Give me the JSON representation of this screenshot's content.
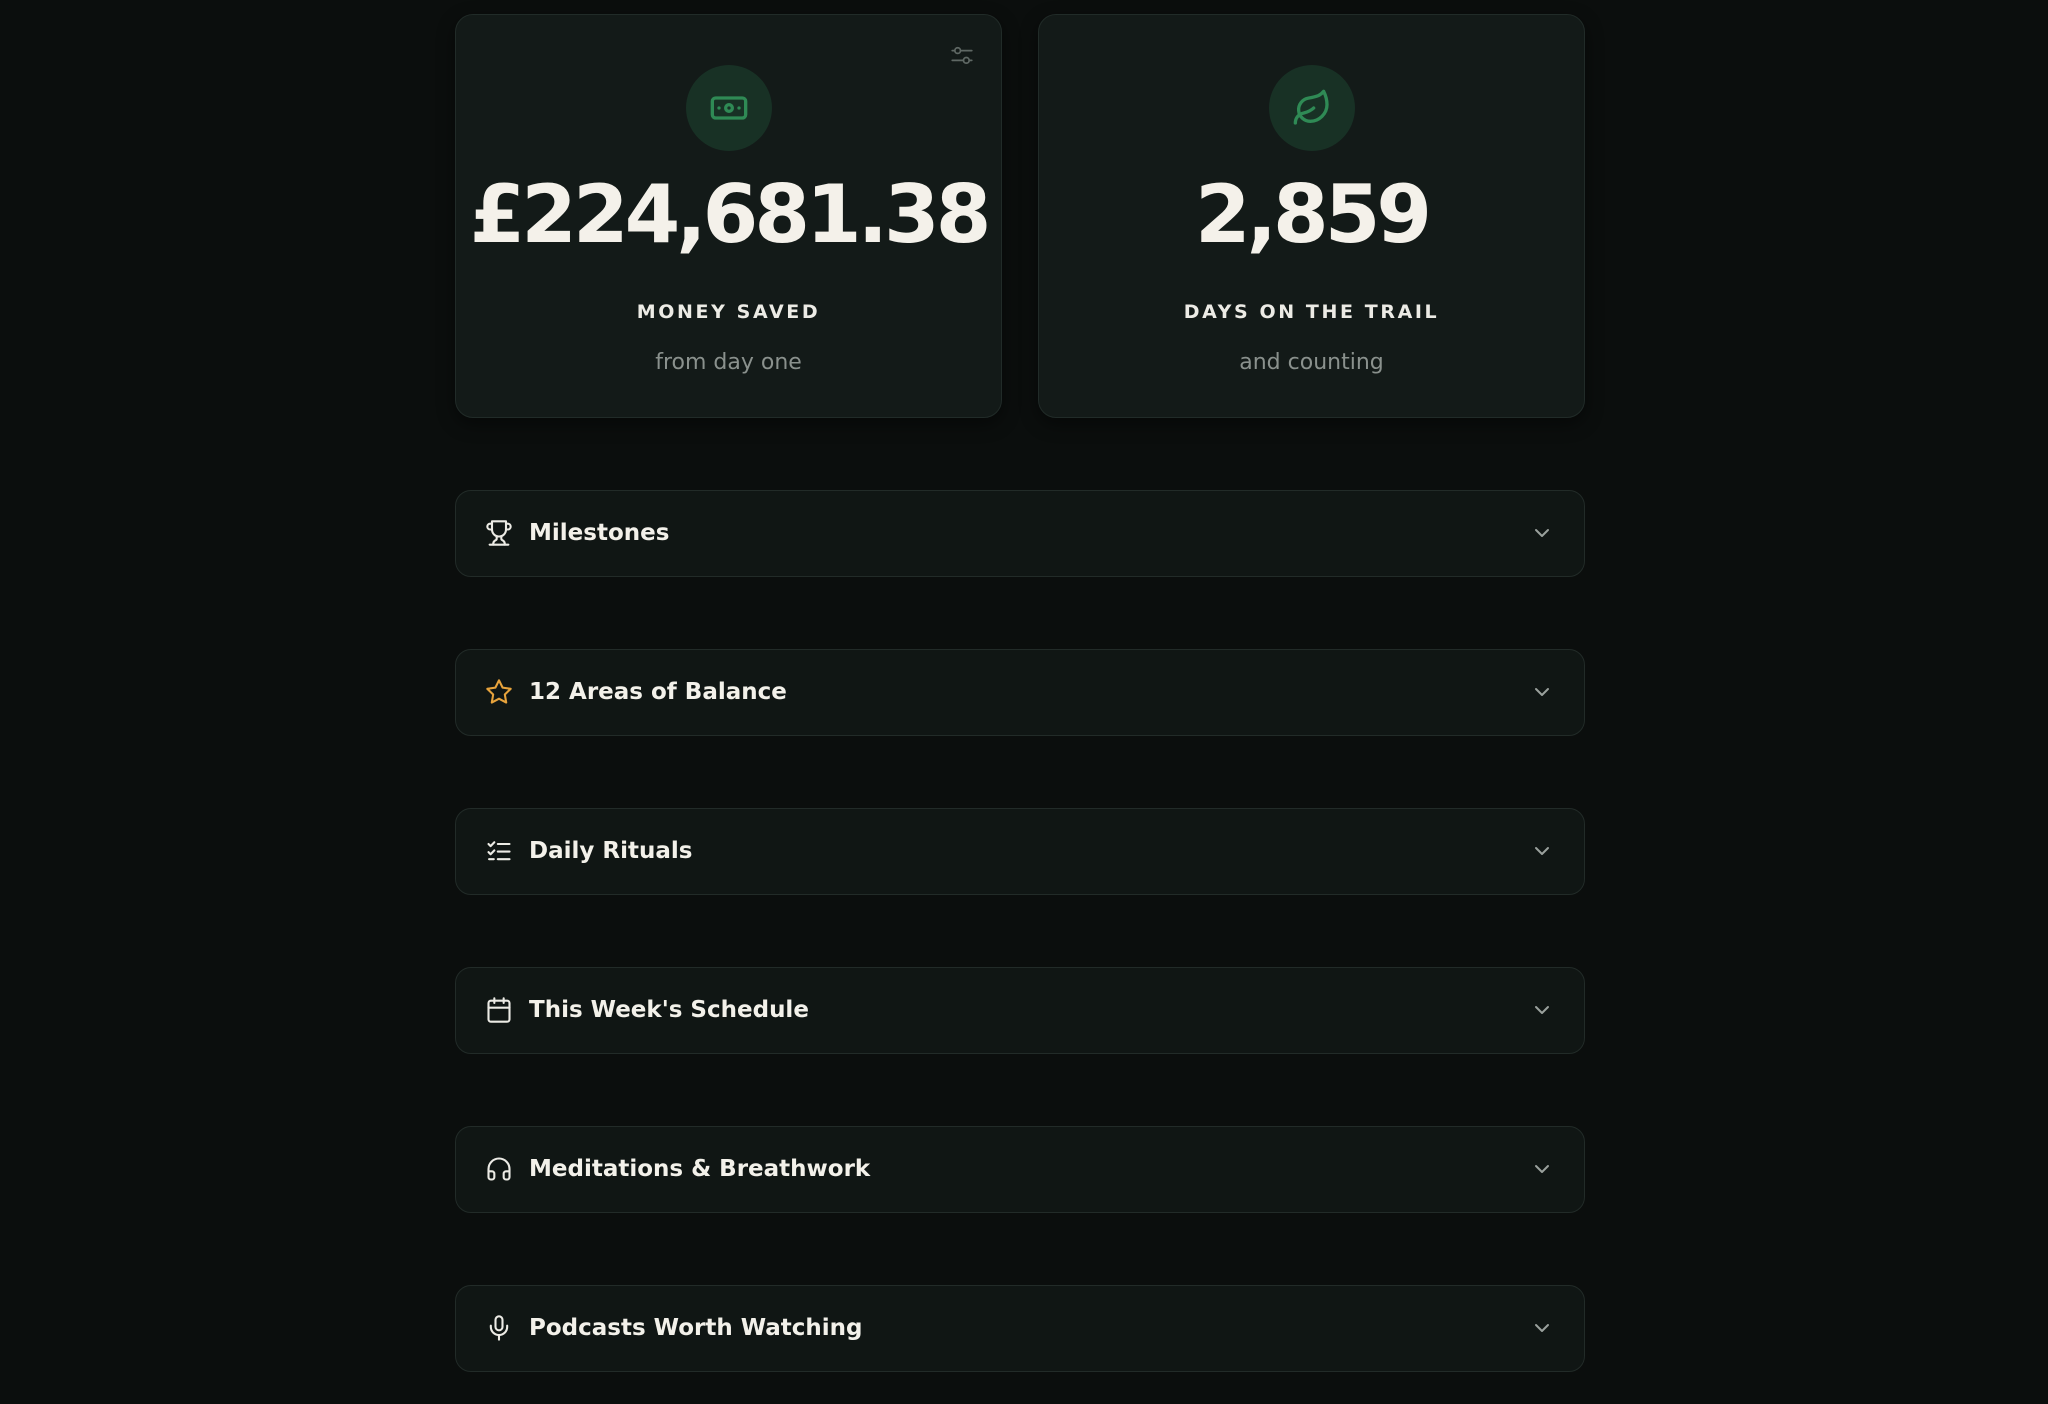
{
  "stats": {
    "money": {
      "value": "£224,681.38",
      "label": "MONEY SAVED",
      "sub": "from day one",
      "icon": "banknote-icon"
    },
    "days": {
      "value": "2,859",
      "label": "DAYS ON THE TRAIL",
      "sub": "and counting",
      "icon": "leaf-icon"
    },
    "settings_icon": "sliders-icon"
  },
  "sections": [
    {
      "title": "Milestones",
      "icon": "trophy-icon"
    },
    {
      "title": "12 Areas of Balance",
      "icon": "star-icon"
    },
    {
      "title": "Daily Rituals",
      "icon": "checklist-icon"
    },
    {
      "title": "This Week's Schedule",
      "icon": "calendar-icon"
    },
    {
      "title": "Meditations & Breathwork",
      "icon": "headphones-icon"
    },
    {
      "title": "Podcasts Worth Watching",
      "icon": "microphone-icon"
    }
  ],
  "colors": {
    "background": "#0b0e0d",
    "card": "#131a18",
    "accent_green": "#2f8a55",
    "star_gold": "#e7a33c"
  }
}
